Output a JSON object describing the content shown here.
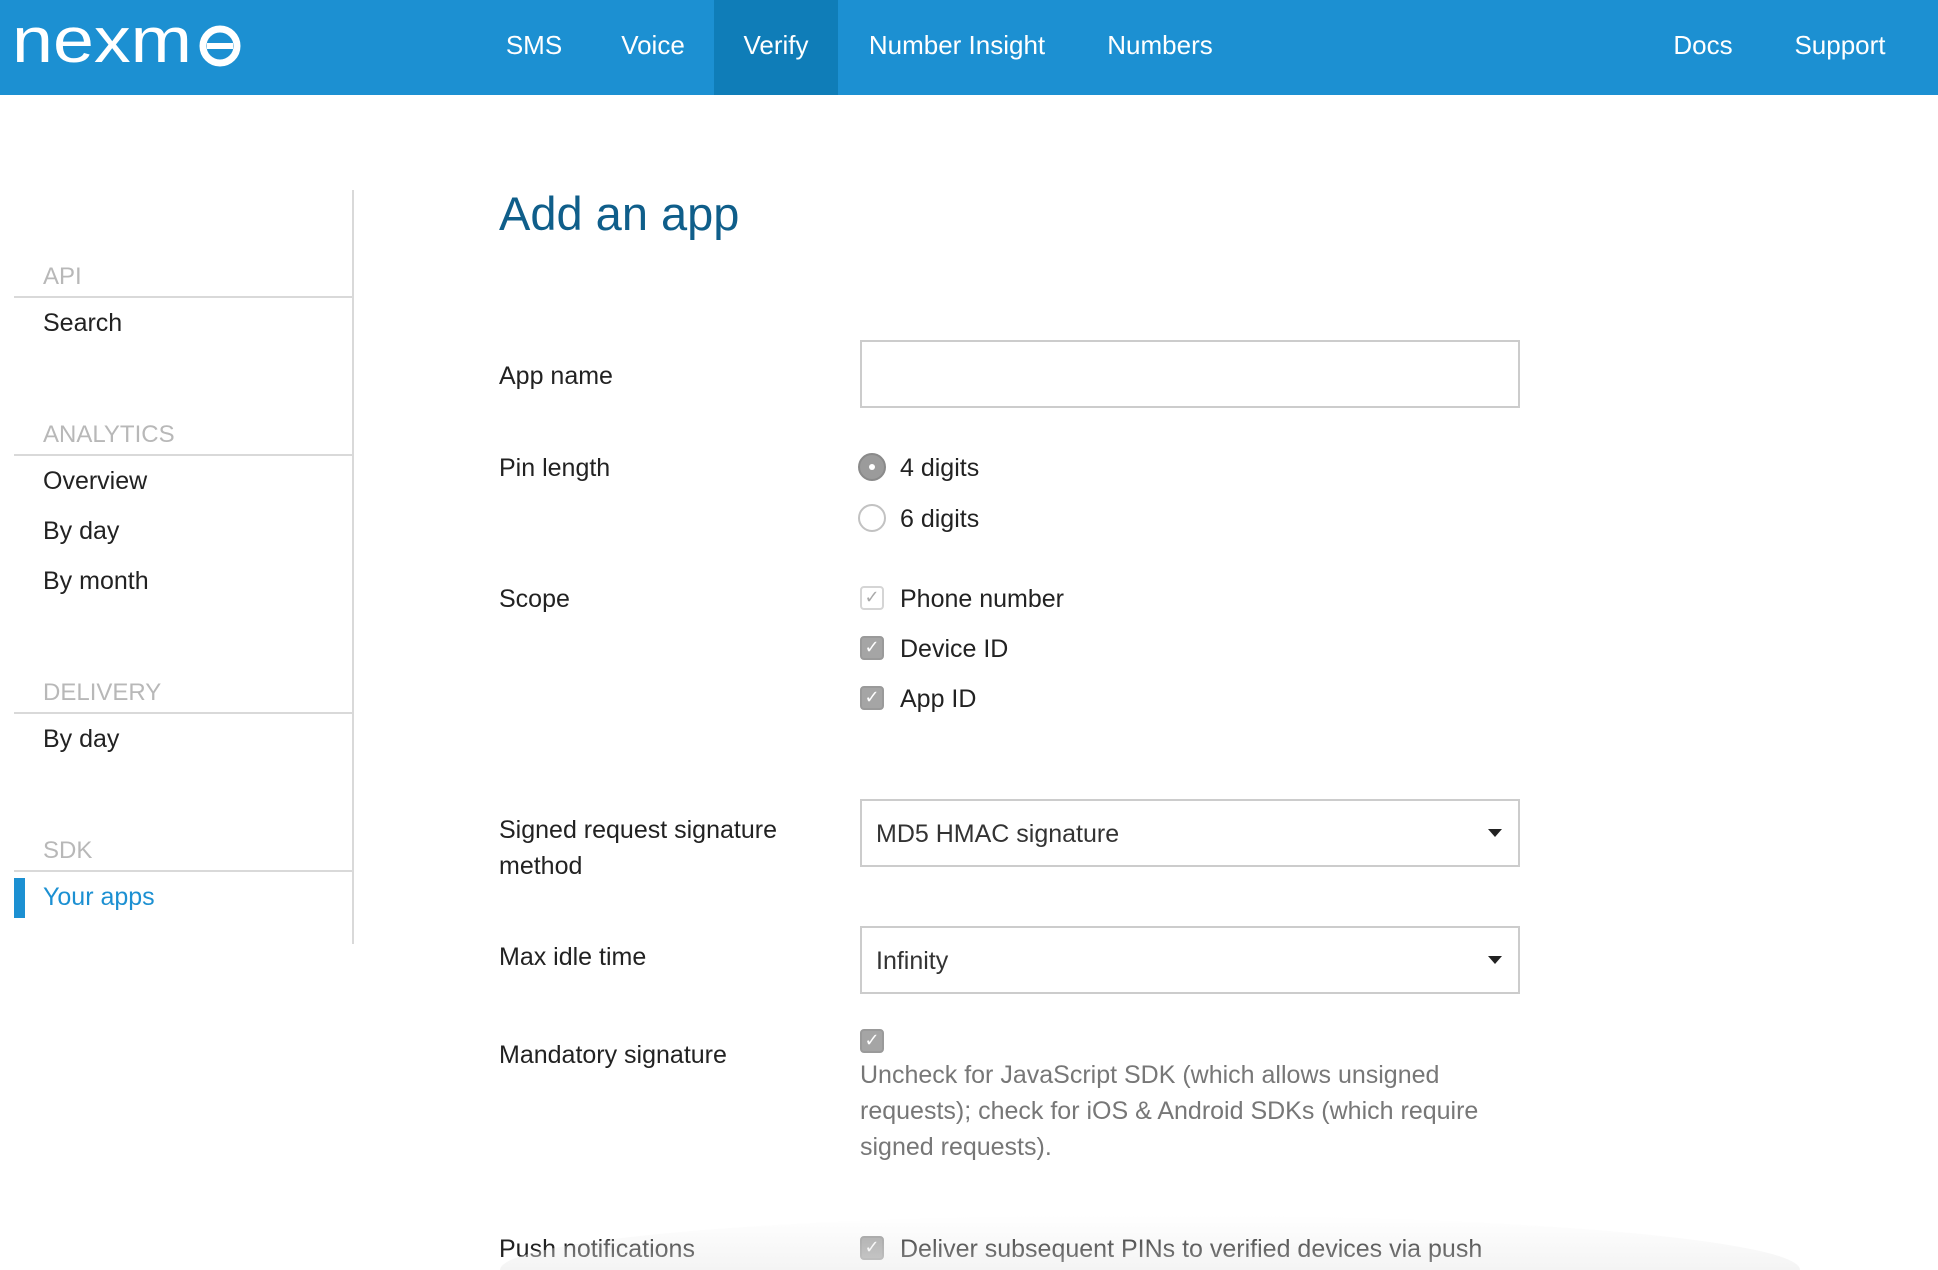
{
  "brand": {
    "logo_text": "nexmo",
    "primary_color": "#1c90d2",
    "active_nav_color": "#0f7db8"
  },
  "nav": {
    "sms": "SMS",
    "voice": "Voice",
    "verify": "Verify",
    "number_insight": "Number Insight",
    "numbers": "Numbers",
    "docs": "Docs",
    "support": "Support",
    "active": "Verify"
  },
  "sidebar": {
    "api": {
      "heading": "API",
      "items": [
        "Search"
      ]
    },
    "analytics": {
      "heading": "ANALYTICS",
      "items": [
        "Overview",
        "By day",
        "By month"
      ]
    },
    "delivery": {
      "heading": "DELIVERY",
      "items": [
        "By day"
      ]
    },
    "sdk": {
      "heading": "SDK",
      "items": [
        "Your apps"
      ],
      "active": "Your apps"
    }
  },
  "form": {
    "title": "Add an app",
    "app_name": {
      "label": "App name",
      "value": ""
    },
    "pin_length": {
      "label": "Pin length",
      "options": [
        {
          "label": "4 digits",
          "checked": true
        },
        {
          "label": "6 digits",
          "checked": false
        }
      ]
    },
    "scope": {
      "label": "Scope",
      "options": [
        {
          "label": "Phone number",
          "checked": true,
          "disabled": true
        },
        {
          "label": "Device ID",
          "checked": true,
          "disabled": false
        },
        {
          "label": "App ID",
          "checked": true,
          "disabled": false
        }
      ]
    },
    "signature_method": {
      "label": "Signed request signature method",
      "value": "MD5 HMAC signature"
    },
    "max_idle_time": {
      "label": "Max idle time",
      "value": "Infinity"
    },
    "mandatory_signature": {
      "label": "Mandatory signature",
      "checked": true,
      "help": "Uncheck for JavaScript SDK (which allows unsigned requests); check for iOS & Android SDKs (which require signed requests)."
    },
    "push_notifications": {
      "label": "Push notifications",
      "checked": true,
      "option_label": "Deliver subsequent PINs to verified devices via push"
    }
  }
}
